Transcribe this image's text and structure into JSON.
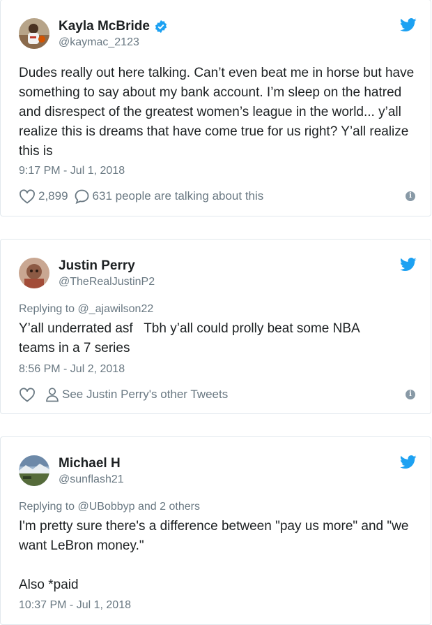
{
  "tweets": [
    {
      "name": "Kayla McBride",
      "handle": "@kaymac_2123",
      "verified": true,
      "text": "Dudes really out here talking. Can’t even beat me in horse but have something to say about my bank account. I’m sleep on the hatred and disrespect of the greatest women’s league in the world... y’all realize this is dreams that have come true for us right? Y’all realize this is",
      "time": "9:17 PM - Jul 1, 2018",
      "likes": "2,899",
      "talking": "631 people are talking about this"
    },
    {
      "name": "Justin Perry",
      "handle": "@TheRealJustinP2",
      "replying_prefix": "Replying to ",
      "replying_target": "@_ajawilson22",
      "text": "Y’all underrated asf   Tbh y’all could prolly beat some NBA teams in a 7 series",
      "time": "8:56 PM - Jul 2, 2018",
      "other_tweets": "See Justin Perry's other Tweets"
    },
    {
      "name": "Michael H",
      "handle": "@sunflash21",
      "replying_prefix": "Replying to ",
      "replying_target": "@UBobbyp and 2 others",
      "text": "I'm pretty sure there's a difference between \"pay us more\" and \"we want LeBron money.\"\n\nAlso *paid",
      "time": "10:37 PM - Jul 1, 2018"
    }
  ],
  "colors": {
    "twitter_blue": "#1da1f2",
    "muted": "#697882",
    "border": "#e1e8ed"
  },
  "icons": {
    "bird": "twitter-bird-icon",
    "verified": "verified-badge-icon",
    "heart": "heart-icon",
    "comment": "comment-icon",
    "person": "person-icon",
    "info": "info-icon"
  }
}
